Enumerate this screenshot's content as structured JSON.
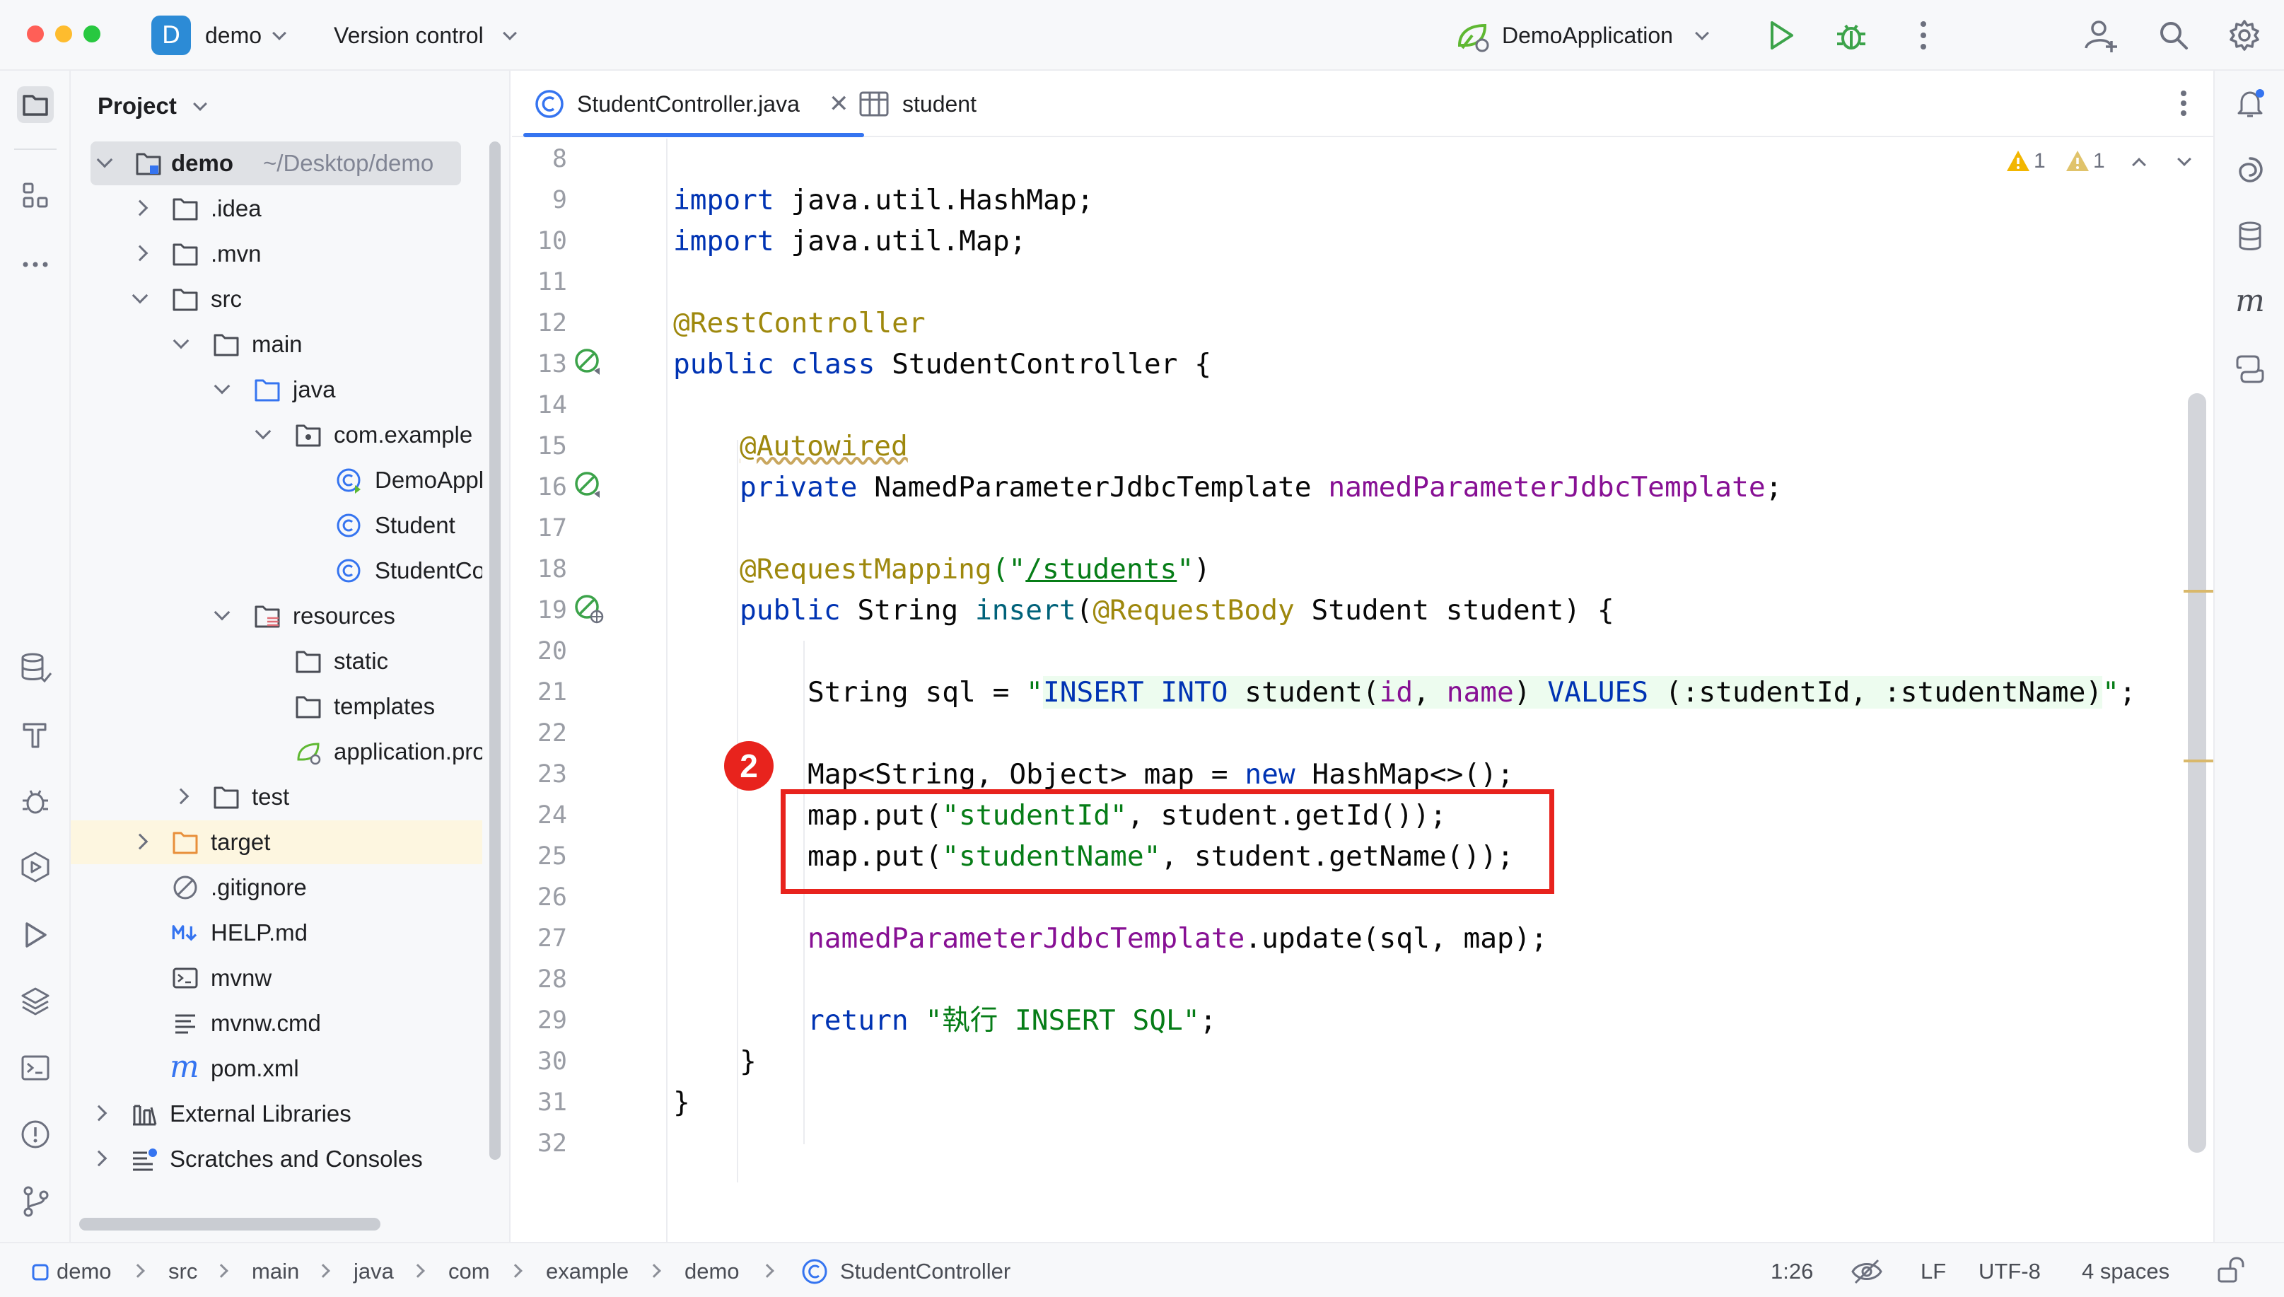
{
  "titlebar": {
    "project_badge": "D",
    "project_name": "demo",
    "vcs_label": "Version control",
    "run_config": "DemoApplication"
  },
  "project_panel": {
    "title": "Project",
    "root_name": "demo",
    "root_path": "~/Desktop/demo",
    "items": [
      {
        "label": ".idea"
      },
      {
        "label": ".mvn"
      },
      {
        "label": "src"
      },
      {
        "label": "main"
      },
      {
        "label": "java"
      },
      {
        "label": "com.example"
      },
      {
        "label": "DemoApplication"
      },
      {
        "label": "Student"
      },
      {
        "label": "StudentController"
      },
      {
        "label": "resources"
      },
      {
        "label": "static"
      },
      {
        "label": "templates"
      },
      {
        "label": "application.properties"
      },
      {
        "label": "test"
      },
      {
        "label": "target"
      },
      {
        "label": ".gitignore"
      },
      {
        "label": "HELP.md"
      },
      {
        "label": "mvnw"
      },
      {
        "label": "mvnw.cmd"
      },
      {
        "label": "pom.xml"
      },
      {
        "label": "External Libraries"
      },
      {
        "label": "Scratches and Consoles"
      }
    ]
  },
  "tabs": [
    {
      "label": "StudentController.java"
    },
    {
      "label": "student"
    }
  ],
  "inspections": {
    "warnings_a": "1",
    "warnings_b": "1"
  },
  "editor": {
    "line_numbers": [
      "8",
      "9",
      "10",
      "11",
      "12",
      "13",
      "14",
      "15",
      "16",
      "17",
      "18",
      "19",
      "20",
      "21",
      "22",
      "23",
      "24",
      "25",
      "26",
      "27",
      "28",
      "29",
      "30",
      "31",
      "32"
    ],
    "code": {
      "import1_kw": "import",
      "import1_rest": " java.util.HashMap;",
      "import2_kw": "import",
      "import2_rest": " java.util.Map;",
      "rest_controller": "@RestController",
      "class_public": "public",
      "class_class": "class",
      "class_name": " StudentController {",
      "autowired": "@Autowired",
      "field_private": "private",
      "field_type": " NamedParameterJdbcTemplate ",
      "field_name": "namedParameterJdbcTemplate",
      "field_end": ";",
      "request_mapping": "@RequestMapping",
      "rm_open": "(\"",
      "rm_path": "/students",
      "rm_close_q": "\"",
      "rm_close": ")",
      "method_public": "public",
      "method_ret": " String ",
      "method_name": "insert",
      "method_paren": "(",
      "method_ann": "@RequestBody",
      "method_rest": " Student student) {",
      "sql_start": "String sql = ",
      "sql_q": "\"",
      "sql_insert": "INSERT INTO",
      "sql_table": " student(",
      "sql_id": "id",
      "sql_comma": ", ",
      "sql_name": "name",
      "sql_close": ") ",
      "sql_values": "VALUES",
      "sql_params": " (:studentId, :studentName)",
      "sql_end_q": "\"",
      "sql_semi": ";",
      "map_decl": "Map<String, Object> map = ",
      "map_new": "new",
      "map_rest": " HashMap<>();",
      "put1_a": "map.put(",
      "put1_s": "\"studentId\"",
      "put1_b": ", student.getId());",
      "put2_a": "map.put(",
      "put2_s": "\"studentName\"",
      "put2_b": ", student.getName());",
      "update_field": "namedParameterJdbcTemplate",
      "update_rest": ".update(sql, map);",
      "return_kw": "return",
      "return_str": " \"執行 INSERT SQL\"",
      "return_semi": ";",
      "close_method": "}",
      "close_class": "}"
    }
  },
  "annotation": {
    "badge": "2"
  },
  "statusbar": {
    "crumbs": [
      "demo",
      "src",
      "main",
      "java",
      "com",
      "example",
      "demo",
      "StudentController"
    ],
    "position": "1:26",
    "line_sep": "LF",
    "encoding": "UTF-8",
    "indent": "4 spaces"
  }
}
